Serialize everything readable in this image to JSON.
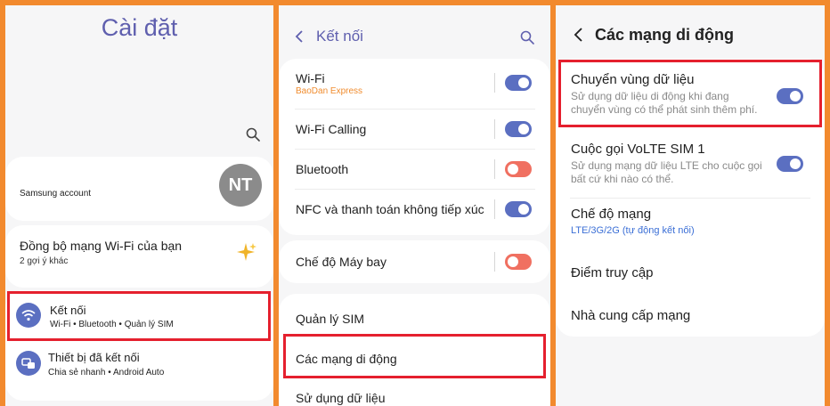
{
  "colors": {
    "frame": "#f28a2e",
    "title": "#5f5fae",
    "toggle_on": "#5b6fc1",
    "toggle_off": "#f07061",
    "highlight": "#e5202e"
  },
  "settings": {
    "title": "Cài đặt",
    "samsung_account": "Samsung account",
    "avatar_initials": "NT",
    "wifi_sync": {
      "title": "Đồng bộ mạng Wi-Fi của bạn",
      "subtitle": "2 gợi ý khác"
    },
    "connections": {
      "title": "Kết nối",
      "subtitle": "Wi-Fi • Bluetooth • Quản lý SIM",
      "icon": "wifi-icon"
    },
    "connected_devices": {
      "title": "Thiết bị đã kết nối",
      "subtitle": "Chia sẻ nhanh • Android Auto",
      "icon": "connected-devices-icon"
    }
  },
  "connections_screen": {
    "title": "Kết nối",
    "wifi": {
      "label": "Wi-Fi",
      "network": "BaoDan Express",
      "on": true
    },
    "wifi_calling": {
      "label": "Wi-Fi Calling",
      "on": true
    },
    "bluetooth": {
      "label": "Bluetooth",
      "on": false
    },
    "nfc": {
      "label": "NFC và thanh toán không tiếp xúc",
      "on": true
    },
    "airplane": {
      "label": "Chế độ Máy bay",
      "on": false
    },
    "sim_manager": "Quản lý SIM",
    "mobile_networks": "Các mạng di động",
    "data_usage": "Sử dụng dữ liệu"
  },
  "mobile_networks_screen": {
    "title": "Các mạng di động",
    "roaming": {
      "title": "Chuyển vùng dữ liệu",
      "desc_line1": "Sử dụng dữ liệu di động khi đang",
      "desc_line2": "chuyển vùng có thể phát sinh thêm phí.",
      "on": true
    },
    "volte": {
      "title": "Cuộc gọi VoLTE SIM 1",
      "desc_line1": "Sử dụng mạng dữ liệu LTE cho cuộc gọi",
      "desc_line2": "bất cứ khi nào có thể.",
      "on": true
    },
    "network_mode": {
      "title": "Chế độ mạng",
      "value": "LTE/3G/2G (tự động kết nối)"
    },
    "access_point": "Điểm truy cập",
    "operators": "Nhà cung cấp mạng"
  }
}
